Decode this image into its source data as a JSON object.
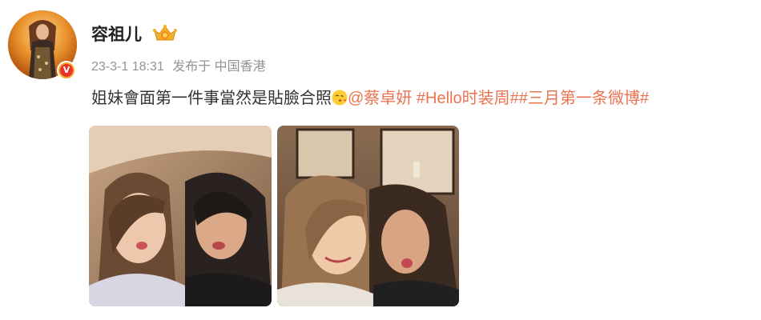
{
  "post": {
    "username": "容祖儿",
    "time": "23-3-1 18:31",
    "source": "发布于 中国香港",
    "text": "姐妹會面第一件事當然是貼臉合照",
    "mention": "@蔡卓妍",
    "topics": [
      "#Hello时装周#",
      "#三月第一条微博#"
    ]
  },
  "icons": {
    "avatar_badge": "verified-v-badge",
    "vip": "vip-crown-icon",
    "emoji": "kiss-emoji"
  },
  "colors": {
    "link": "#eb7350",
    "meta": "#939393",
    "badge_orange": "#f5a623",
    "badge_red": "#e8332a"
  }
}
